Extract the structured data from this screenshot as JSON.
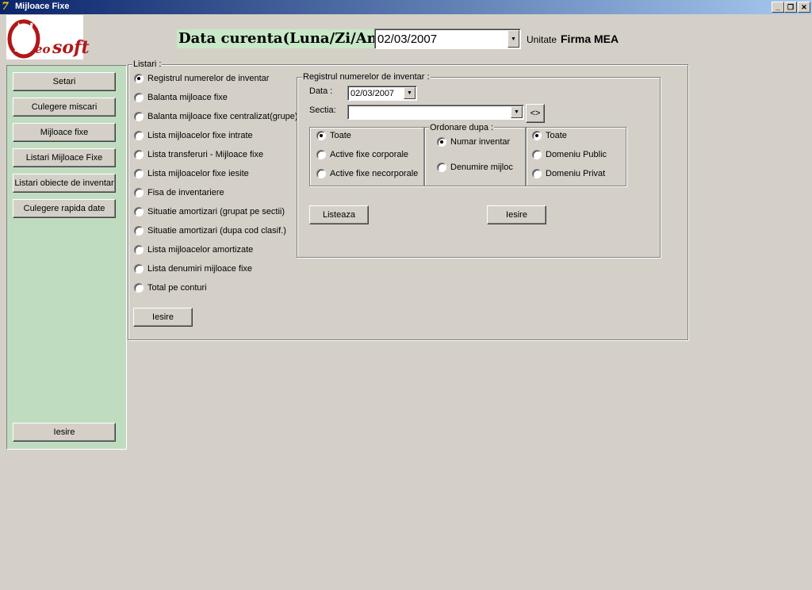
{
  "window": {
    "title": "Mijloace Fixe",
    "controls": {
      "minimize": "_",
      "restore": "❐",
      "close": "✕"
    }
  },
  "logo": {
    "text_top": "eo",
    "text_bottom": "soft",
    "mark": "®"
  },
  "header": {
    "date_label": "Data curenta(Luna/Zi/An):",
    "date_value": "02/03/2007",
    "unit_label": "Unitate",
    "unit_value": "Firma MEA"
  },
  "sidebar": {
    "items": [
      {
        "label": "Setari"
      },
      {
        "label": "Culegere miscari"
      },
      {
        "label": "Mijloace fixe"
      },
      {
        "label": "Listari Mijloace Fixe"
      },
      {
        "label": "Listari obiecte de inventar"
      },
      {
        "label": "Culegere rapida date"
      }
    ],
    "exit_label": "Iesire"
  },
  "listari": {
    "legend": "Listari :",
    "options": [
      {
        "label": "Registrul numerelor de inventar",
        "checked": true
      },
      {
        "label": "Balanta mijloace fixe",
        "checked": false
      },
      {
        "label": "Balanta mijloace fixe centralizat(grupe)",
        "checked": false
      },
      {
        "label": "Lista mijloacelor fixe intrate",
        "checked": false
      },
      {
        "label": "Lista transferuri - Mijloace fixe",
        "checked": false
      },
      {
        "label": "Lista mijloacelor fixe iesite",
        "checked": false
      },
      {
        "label": "Fisa de inventariere",
        "checked": false
      },
      {
        "label": "Situatie amortizari (grupat pe sectii)",
        "checked": false
      },
      {
        "label": "Situatie amortizari (dupa cod clasif.)",
        "checked": false
      },
      {
        "label": "Lista mijloacelor amortizate",
        "checked": false
      },
      {
        "label": "Lista denumiri mijloace fixe",
        "checked": false
      },
      {
        "label": "Total pe conturi",
        "checked": false
      }
    ],
    "exit_label": "Iesire"
  },
  "registru": {
    "legend": "Registrul numerelor de inventar :",
    "data_label": "Data :",
    "data_value": "02/03/2007",
    "sectia_label": "Sectia:",
    "sectia_value": "",
    "sectia_button": "<>",
    "tip_options": [
      {
        "label": "Toate",
        "checked": true
      },
      {
        "label": "Active fixe corporale",
        "checked": false
      },
      {
        "label": "Active fixe necorporale",
        "checked": false
      }
    ],
    "ordonare_legend": "Ordonare dupa :",
    "ordonare_options": [
      {
        "label": "Numar inventar",
        "checked": true
      },
      {
        "label": "Denumire mijloc",
        "checked": false
      }
    ],
    "domeniu_options": [
      {
        "label": "Toate",
        "checked": true
      },
      {
        "label": "Domeniu Public",
        "checked": false
      },
      {
        "label": "Domeniu Privat",
        "checked": false
      }
    ],
    "list_button": "Listeaza",
    "exit_label": "Iesire"
  },
  "colors": {
    "titlebar_start": "#0a246a",
    "titlebar_end": "#a6caf0",
    "sidebar_bg": "#c0dcc0",
    "header_label_bg": "#c8e8c8",
    "window_bg": "#d4d0c8",
    "logo_red": "#b01818"
  }
}
